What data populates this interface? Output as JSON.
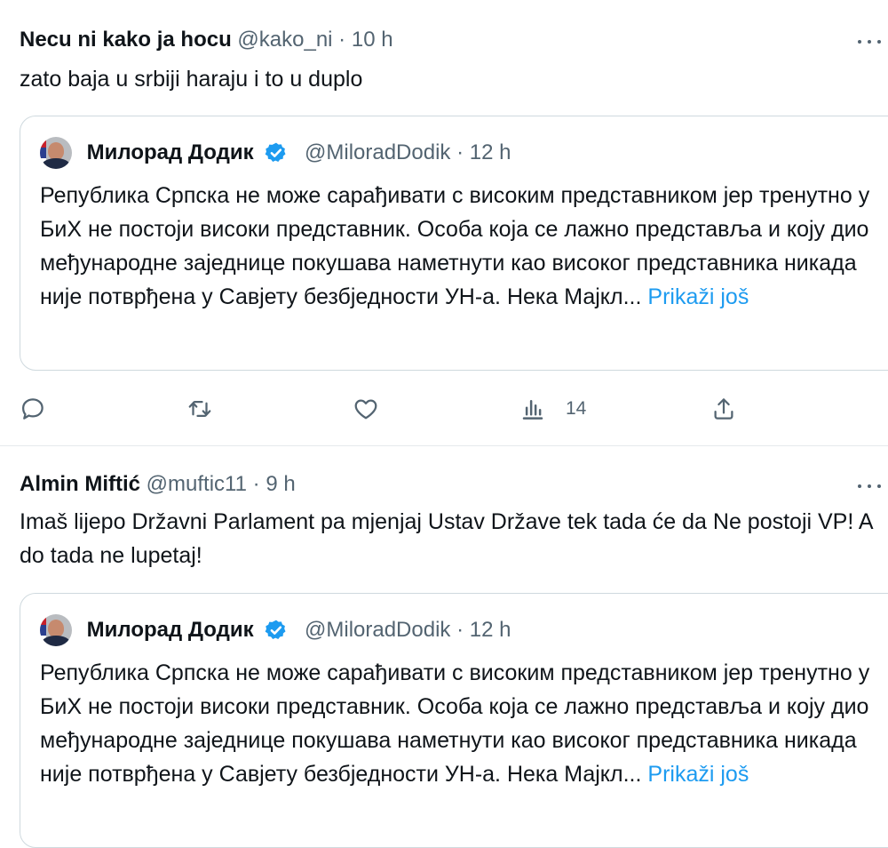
{
  "tweets": [
    {
      "author_name": "Necu ni kako ja hocu",
      "handle": "@kako_ni",
      "separator": "·",
      "time": "10 h",
      "text": "zato baja u srbiji haraju i to u duplo",
      "quote": {
        "author_name": "Милорад Додик",
        "handle": "@MiloradDodik",
        "separator": "·",
        "time": "12 h",
        "text": "Република Српска не може сарађивати с високим представником јер тренутно у БиХ не постоји високи представник. Особа која се лажно представља и коју дио међународне заједнице покушава наметнути као високог представника никада није потврђена у Савјету безбједности УН-а. Нека Мајкл...",
        "show_more": "Prikaži još"
      },
      "actions": {
        "reply_count": "",
        "repost_count": "",
        "like_count": "",
        "views_count": "14"
      }
    },
    {
      "author_name": "Almin Miftić",
      "handle": "@muftic11",
      "separator": "·",
      "time": "9 h",
      "text": "Imaš lijepo Državni Parlament pa mjenjaj Ustav Države tek tada će da Ne postoji VP! A do tada ne lupetaj!",
      "quote": {
        "author_name": "Милорад Додик",
        "handle": "@MiloradDodik",
        "separator": "·",
        "time": "12 h",
        "text": "Република Српска не може сарађивати с високим представником јер тренутно у БиХ не постоји високи представник. Особа која се лажно представља и коју дио међународне заједнице покушава наметнути као високог представника никада није потврђена у Савјету безбједности УН-а. Нека Мајкл...",
        "show_more": "Prikaži još"
      }
    }
  ],
  "colors": {
    "text": "#0f1419",
    "secondary": "#536471",
    "link": "#1d9bf0",
    "border": "#cfd9de",
    "verified": "#1d9bf0"
  },
  "icons": {
    "more": "more-icon",
    "verified": "verified-badge-icon",
    "reply": "reply-icon",
    "repost": "repost-icon",
    "like": "like-icon",
    "views": "views-icon",
    "share": "share-icon"
  }
}
